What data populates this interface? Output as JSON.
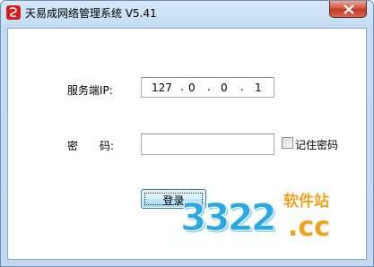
{
  "window": {
    "title": "天易成网络管理系统 V5.41",
    "icon": "app-logo-icon",
    "close_icon": "close-icon"
  },
  "form": {
    "server_ip_label": "服务端IP:",
    "server_ip": {
      "octet1": "127",
      "octet2": "0",
      "octet3": "0",
      "octet4": "1",
      "dot": "."
    },
    "password_label": "密　　码:",
    "password_value": "",
    "remember_password_label": "记住密码",
    "remember_password_checked": false,
    "login_button_label": "登录"
  },
  "watermark": {
    "brand": "3322",
    "suffix": ".cc",
    "tagline": "软件站",
    "colors": {
      "primary": "#2aa9e0",
      "secondary": "#f0a21e"
    }
  },
  "colors": {
    "titlebar_bg": "#c4dcf2",
    "close_button": "#c13b23",
    "button_border": "#3c7fb1"
  }
}
